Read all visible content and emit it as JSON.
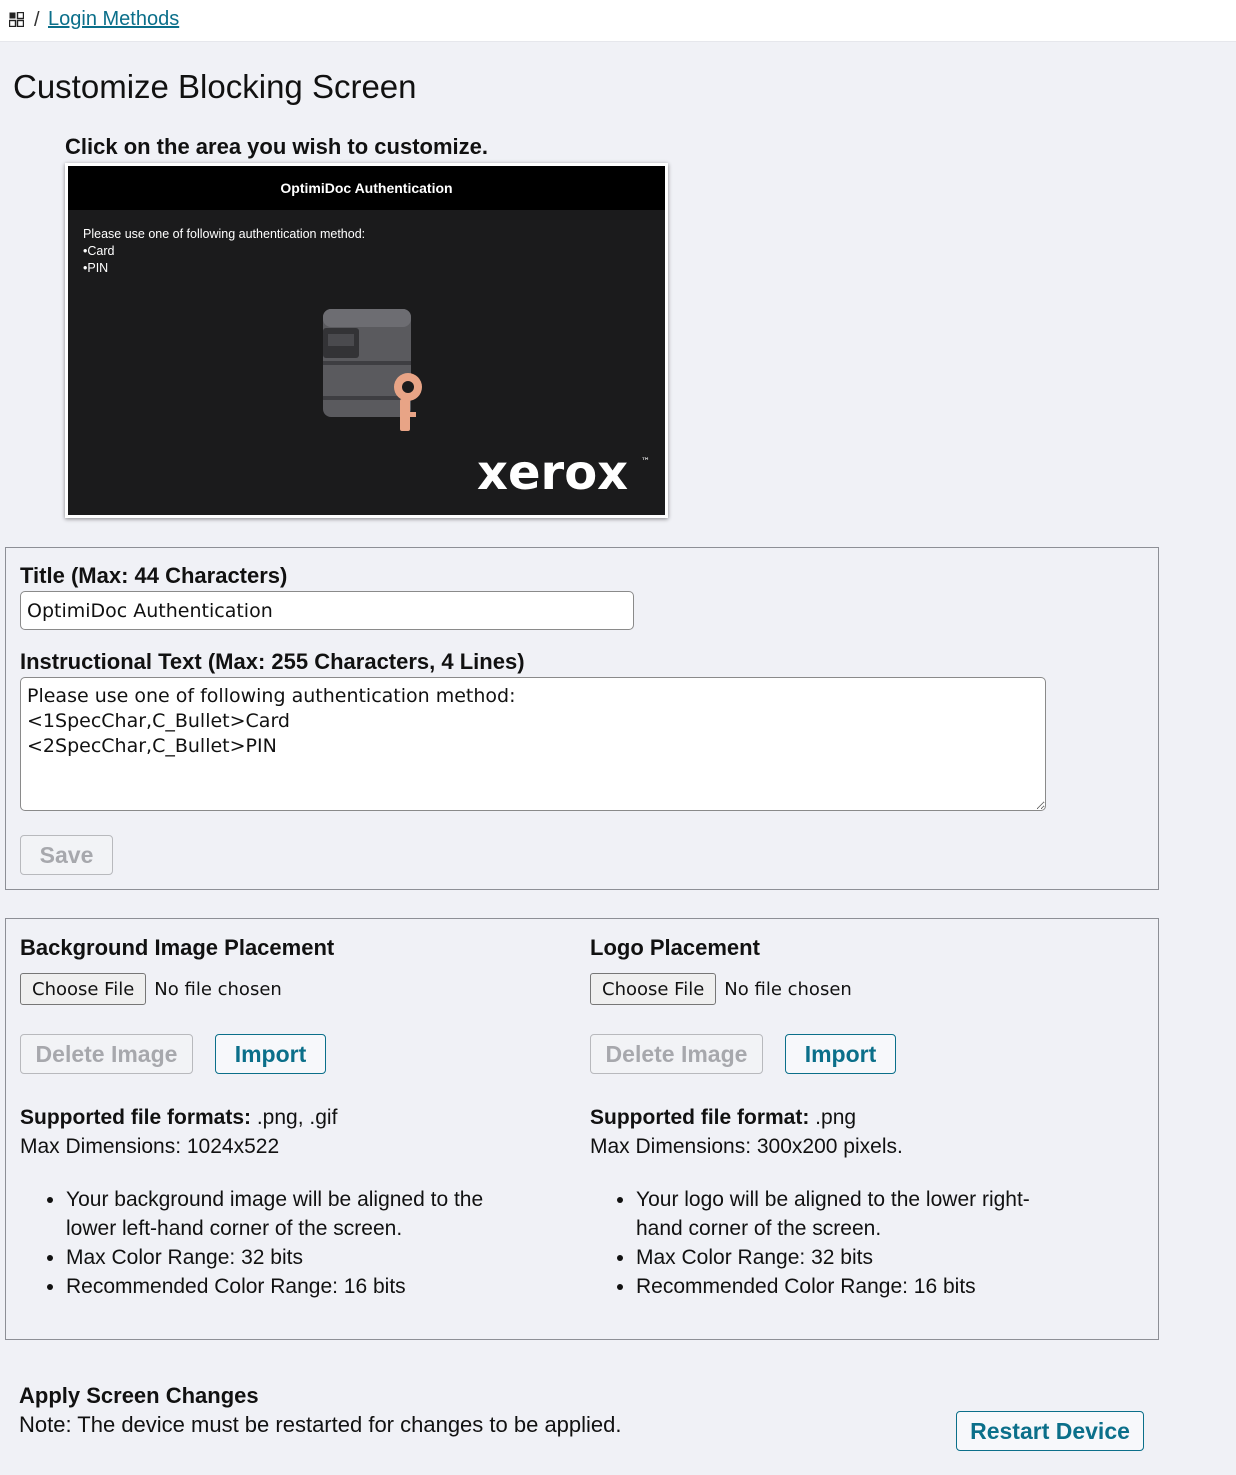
{
  "breadcrumb": {
    "icon": "dashboard-grid-icon",
    "separator": "/",
    "link": "Login Methods"
  },
  "page_title": "Customize Blocking Screen",
  "hint": "Click on the area you wish to customize.",
  "preview": {
    "title": "OptimiDoc Authentication",
    "lines": [
      "Please use one of following authentication method:",
      "•Card",
      "•PIN"
    ],
    "background_image": "printer-key-image",
    "logo_text": "xerox",
    "logo_mark": "™"
  },
  "text_settings": {
    "title_label": "Title (Max: 44 Characters)",
    "title_value": "OptimiDoc Authentication",
    "instr_label": "Instructional Text (Max: 255 Characters, 4 Lines)",
    "instr_value": "Please use one of following authentication method:\n<1SpecChar,C_Bullet>Card\n<2SpecChar,C_Bullet>PIN",
    "save_label": "Save"
  },
  "background": {
    "heading": "Background Image Placement",
    "choose_label": "Choose File",
    "file_status": "No file chosen",
    "delete_label": "Delete Image",
    "import_label": "Import",
    "formats_label": "Supported file formats:",
    "formats_value": " .png, .gif",
    "dimensions": "Max Dimensions: 1024x522",
    "bullets": [
      "Your background image will be aligned to the lower left-hand corner of the screen.",
      "Max Color Range: 32 bits",
      "Recommended Color Range: 16 bits"
    ]
  },
  "logo": {
    "heading": "Logo Placement",
    "choose_label": "Choose File",
    "file_status": "No file chosen",
    "delete_label": "Delete Image",
    "import_label": "Import",
    "formats_label": "Supported file format:",
    "formats_value": " .png",
    "dimensions": "Max Dimensions: 300x200 pixels.",
    "bullets": [
      "Your logo will be aligned to the lower right-hand corner of the screen.",
      "Max Color Range: 32 bits",
      "Recommended Color Range: 16 bits"
    ]
  },
  "apply": {
    "heading": "Apply Screen Changes",
    "note": "Note: The device must be restarted for changes to be applied.",
    "restart_label": "Restart Device"
  },
  "colors": {
    "accent": "#0b6f8a",
    "page_bg": "#f0f1f6",
    "preview_bg": "#1b1b1c",
    "disabled_text": "#a7a8ad"
  }
}
